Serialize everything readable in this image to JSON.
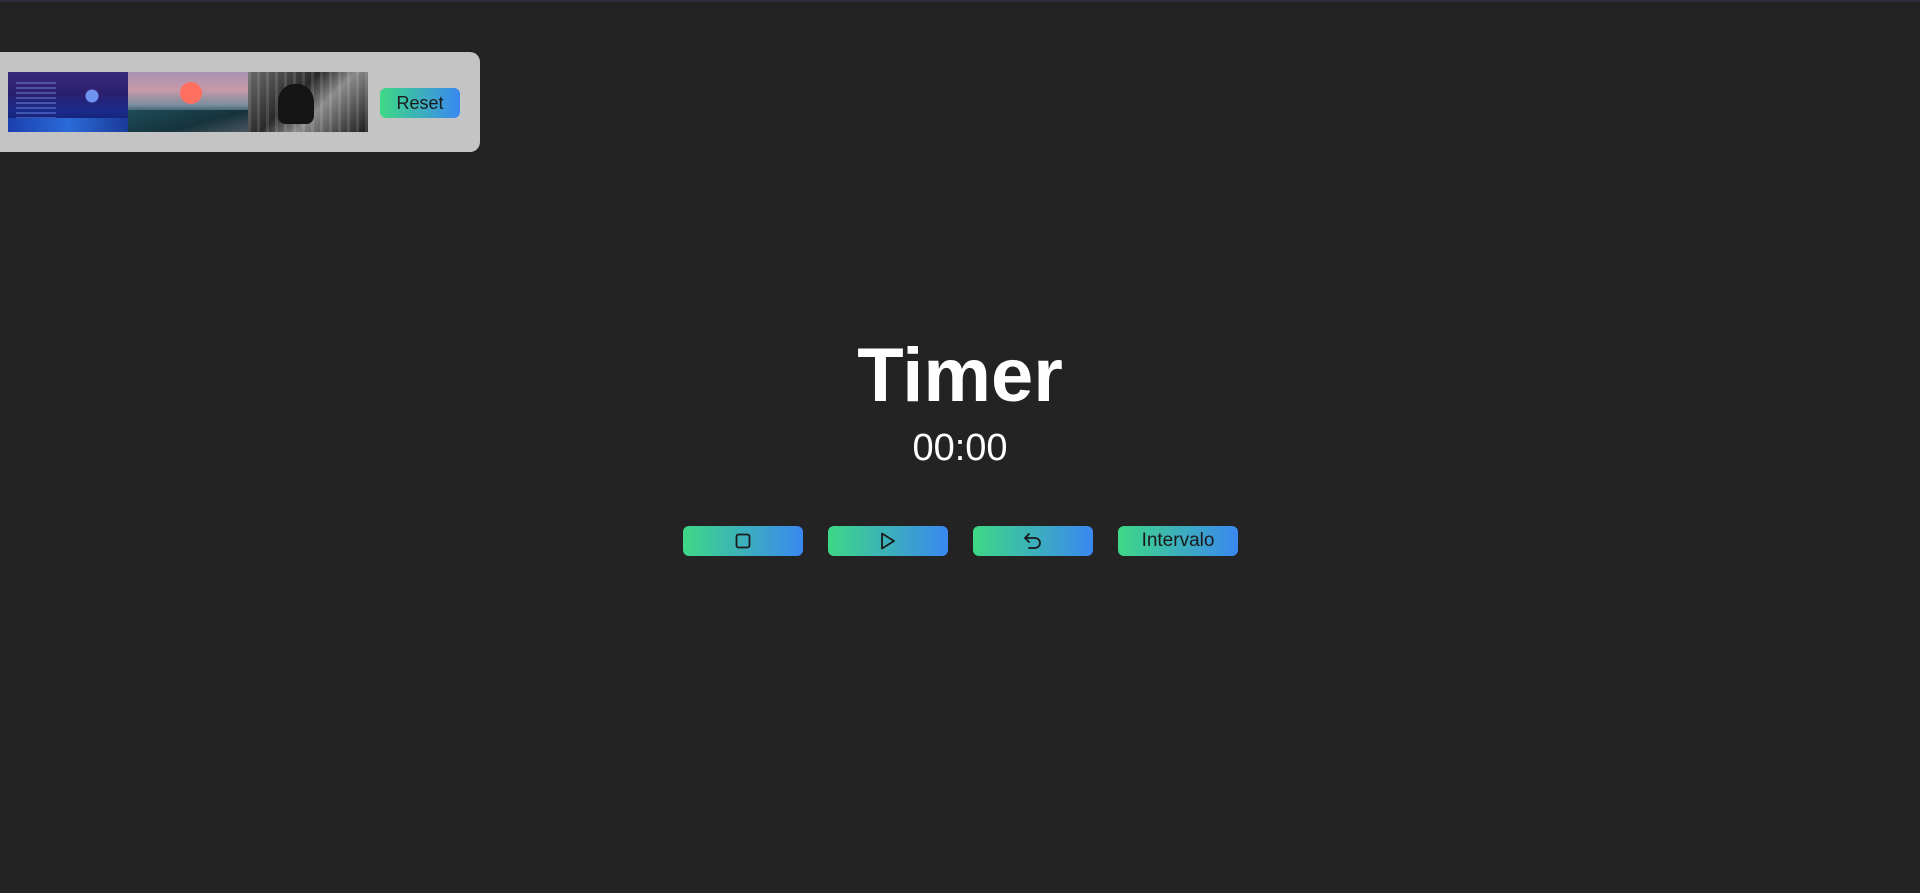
{
  "background_panel": {
    "thumbnails": [
      {
        "icon": "city-night-thumbnail"
      },
      {
        "icon": "sunset-road-thumbnail"
      },
      {
        "icon": "grayscale-portrait-thumbnail"
      }
    ],
    "reset_label": "Reset"
  },
  "timer": {
    "title": "Timer",
    "time": "00:00"
  },
  "controls": {
    "stop_icon": "stop-icon",
    "play_icon": "play-icon",
    "restart_icon": "undo-icon",
    "interval_label": "Intervalo"
  },
  "colors": {
    "background": "#232323",
    "panel": "#c4c4c4",
    "button_gradient_start": "#3ed886",
    "button_gradient_end": "#3a88f0",
    "text": "#ffffff"
  }
}
